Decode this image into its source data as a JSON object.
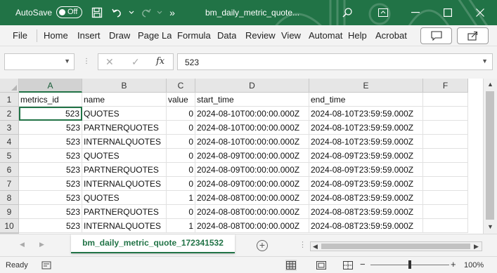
{
  "titlebar": {
    "autosave_label": "AutoSave",
    "autosave_state": "Off",
    "filename": "bm_daily_metric_quote...",
    "more_label": "»"
  },
  "ribbon": {
    "tabs": [
      "File",
      "Home",
      "Insert",
      "Draw",
      "Page La",
      "Formula",
      "Data",
      "Review",
      "View",
      "Automat",
      "Help",
      "Acrobat"
    ]
  },
  "formula_bar": {
    "name_box": "",
    "cancel_glyph": "✕",
    "enter_glyph": "✓",
    "fx_label": "fx",
    "value": "523"
  },
  "grid": {
    "columns": [
      "A",
      "B",
      "C",
      "D",
      "E",
      "F"
    ],
    "selected_column": "A",
    "rows": [
      [
        "1",
        "metrics_id",
        "name",
        "value",
        "start_time",
        "end_time",
        ""
      ],
      [
        "2",
        "523",
        "QUOTES",
        "0",
        "2024-08-10T00:00:00.000Z",
        "2024-08-10T23:59:59.000Z",
        ""
      ],
      [
        "3",
        "523",
        "PARTNERQUOTES",
        "0",
        "2024-08-10T00:00:00.000Z",
        "2024-08-10T23:59:59.000Z",
        ""
      ],
      [
        "4",
        "523",
        "INTERNALQUOTES",
        "0",
        "2024-08-10T00:00:00.000Z",
        "2024-08-10T23:59:59.000Z",
        ""
      ],
      [
        "5",
        "523",
        "QUOTES",
        "0",
        "2024-08-09T00:00:00.000Z",
        "2024-08-09T23:59:59.000Z",
        ""
      ],
      [
        "6",
        "523",
        "PARTNERQUOTES",
        "0",
        "2024-08-09T00:00:00.000Z",
        "2024-08-09T23:59:59.000Z",
        ""
      ],
      [
        "7",
        "523",
        "INTERNALQUOTES",
        "0",
        "2024-08-09T00:00:00.000Z",
        "2024-08-09T23:59:59.000Z",
        ""
      ],
      [
        "8",
        "523",
        "QUOTES",
        "1",
        "2024-08-08T00:00:00.000Z",
        "2024-08-08T23:59:59.000Z",
        ""
      ],
      [
        "9",
        "523",
        "PARTNERQUOTES",
        "0",
        "2024-08-08T00:00:00.000Z",
        "2024-08-08T23:59:59.000Z",
        ""
      ],
      [
        "10",
        "523",
        "INTERNALQUOTES",
        "1",
        "2024-08-08T00:00:00.000Z",
        "2024-08-08T23:59:59.000Z",
        ""
      ]
    ]
  },
  "sheets": {
    "active": "bm_daily_metric_quote_172341532",
    "add_label": "+"
  },
  "statusbar": {
    "status": "Ready",
    "zoom": "100%",
    "zoom_fraction": 0.5
  },
  "colors": {
    "accent": "#217346",
    "accent_dark": "#185c37"
  },
  "icons": [
    "save-icon",
    "undo-icon",
    "redo-icon",
    "search-icon",
    "ribbon-display-icon",
    "minimize-icon",
    "maximize-icon",
    "close-icon",
    "comment-icon",
    "share-icon",
    "accessibility-icon",
    "normal-view-icon",
    "page-layout-icon",
    "page-break-icon"
  ]
}
